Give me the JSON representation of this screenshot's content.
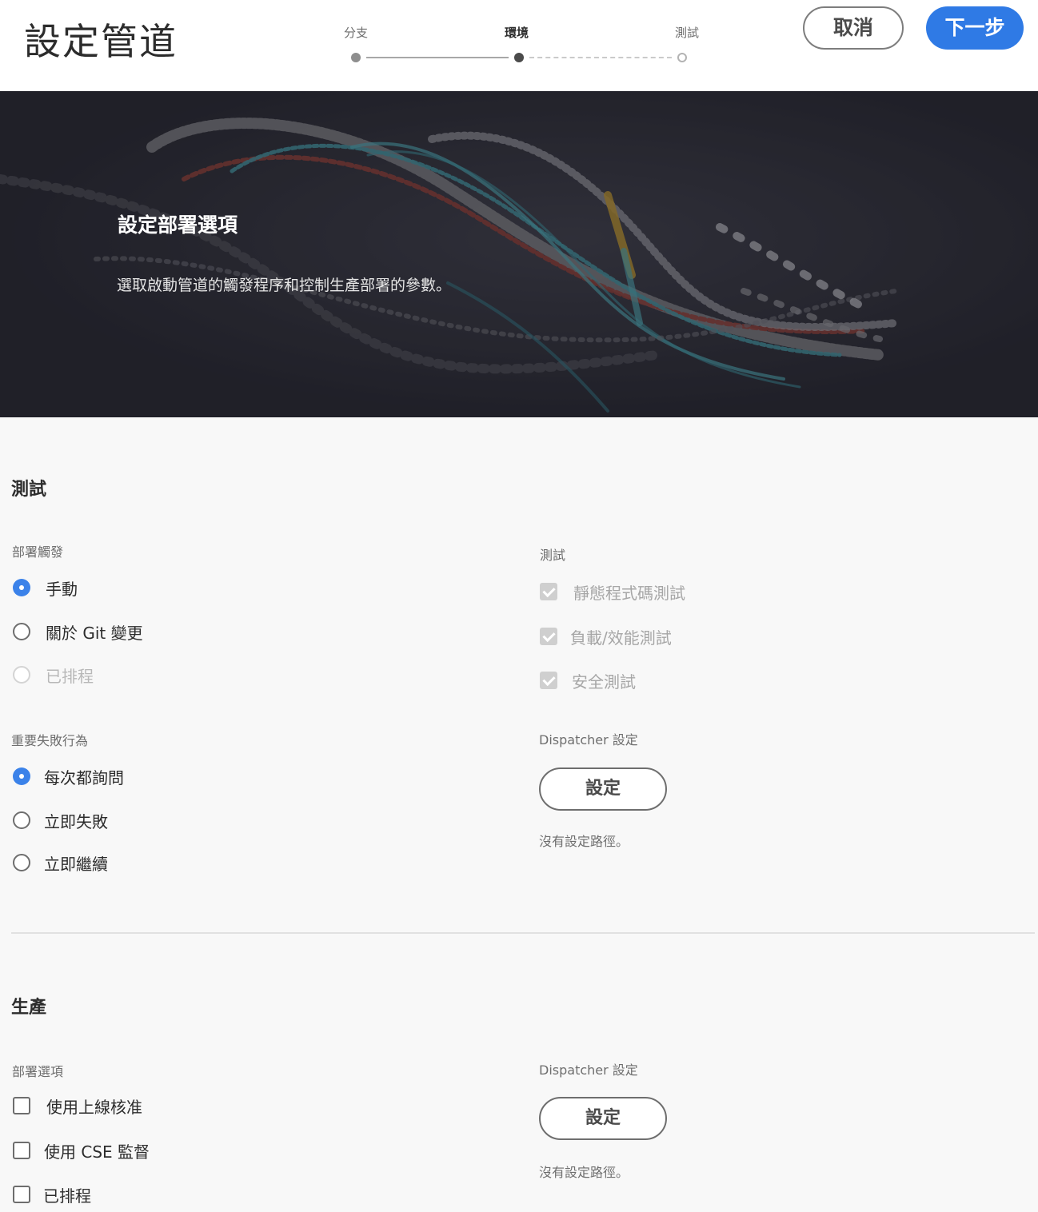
{
  "header": {
    "title": "設定管道",
    "steps": [
      {
        "label": "分支",
        "state": "done"
      },
      {
        "label": "環境",
        "state": "current"
      },
      {
        "label": "測試",
        "state": "todo"
      }
    ],
    "cancel_label": "取消",
    "next_label": "下一步",
    "accent_color": "#2f7ae5"
  },
  "hero": {
    "title": "設定部署選項",
    "description": "選取啟動管道的觸發程序和控制生產部署的參數。"
  },
  "staging": {
    "title": "測試",
    "trigger": {
      "label": "部署觸發",
      "options": [
        {
          "label": "手動",
          "checked": true
        },
        {
          "label": "關於 Git 變更",
          "checked": false
        },
        {
          "label": "已排程",
          "checked": false,
          "disabled": true
        }
      ]
    },
    "failure": {
      "label": "重要失敗行為",
      "options": [
        {
          "label": "每次都詢問",
          "checked": true
        },
        {
          "label": "立即失敗",
          "checked": false
        },
        {
          "label": "立即繼續",
          "checked": false
        }
      ]
    },
    "tests": {
      "label": "測試",
      "items": [
        {
          "label": "靜態程式碼測試",
          "checked": true,
          "disabled": true
        },
        {
          "label": "負載/效能測試",
          "checked": true,
          "disabled": true
        },
        {
          "label": "安全測試",
          "checked": true,
          "disabled": true
        }
      ]
    },
    "dispatcher": {
      "label": "Dispatcher 設定",
      "button": "設定",
      "note": "沒有設定路徑。"
    }
  },
  "production": {
    "title": "生產",
    "options": {
      "label": "部署選項",
      "items": [
        {
          "label": "使用上線核准",
          "checked": false
        },
        {
          "label": "使用 CSE 監督",
          "checked": false
        },
        {
          "label": "已排程",
          "checked": false
        }
      ]
    },
    "dispatcher": {
      "label": "Dispatcher 設定",
      "button": "設定",
      "note": "沒有設定路徑。"
    }
  }
}
